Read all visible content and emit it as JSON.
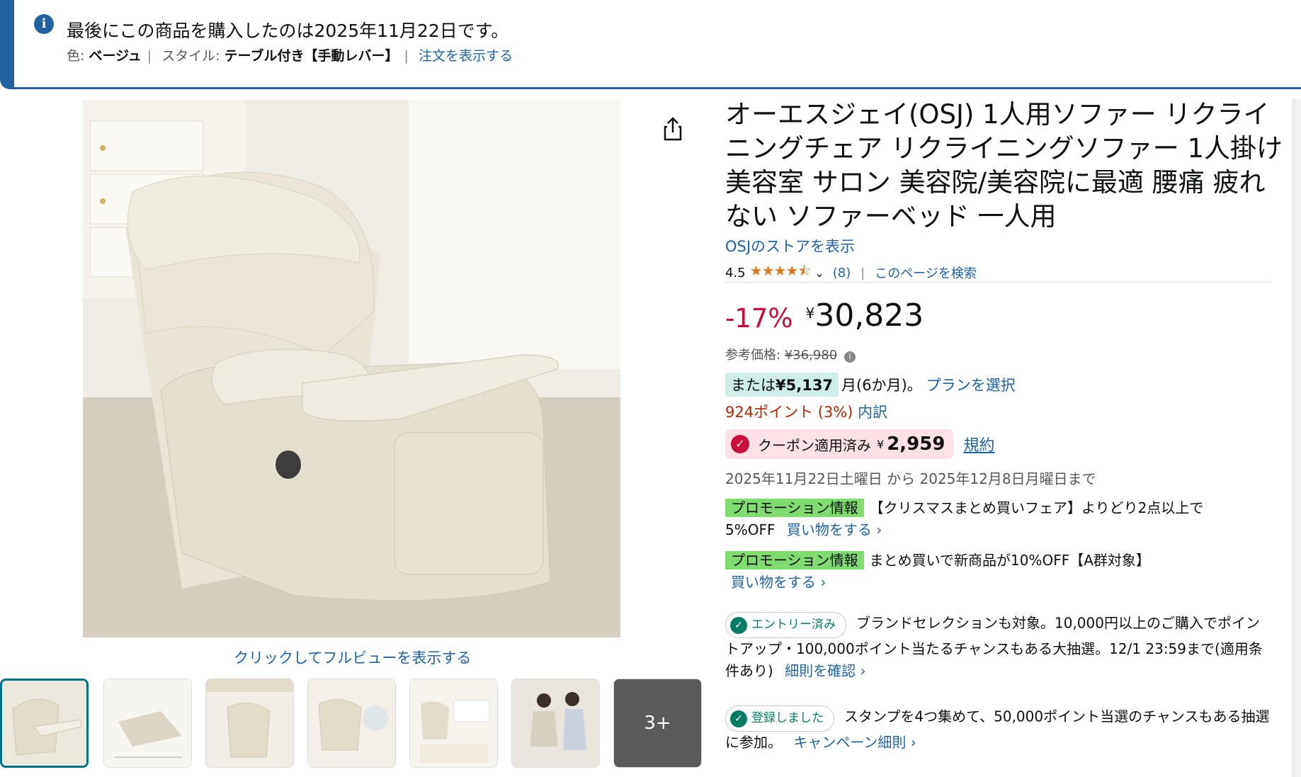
{
  "banner": {
    "title": "最後にこの商品を購入したのは2025年11月22日です。",
    "color_label": "色:",
    "color_value": "ベージュ",
    "style_label": "スタイル:",
    "style_value": "テーブル付き【手動レバー】",
    "view_order": "注文を表示する"
  },
  "gallery": {
    "fullview": "クリックしてフルビューを表示する",
    "thumbnails": [
      {
        "name": "thumb-1",
        "active": true
      },
      {
        "name": "thumb-2"
      },
      {
        "name": "thumb-3"
      },
      {
        "name": "thumb-4"
      },
      {
        "name": "thumb-5"
      },
      {
        "name": "thumb-6"
      }
    ],
    "more": "3+"
  },
  "product": {
    "title": "オーエスジェイ(OSJ) 1人用ソファー リクライニングチェア リクライニングソファー 1人掛け 美容室 サロン 美容院/美容院に最適 腰痛 疲れない ソファーベッド 一人用",
    "store_link": "OSJのストアを表示",
    "rating": "4.5",
    "stars": "★★★★⯪",
    "review_count": "(8)",
    "search_page": "このページを検索"
  },
  "price": {
    "discount": "-17%",
    "currency": "¥",
    "value": "30,823",
    "ref_label": "参考価格:",
    "ref_value": "¥36,980",
    "plan_prefix": "または",
    "plan_amount": "¥5,137",
    "plan_suffix": "月(6か月)。",
    "plan_link": "プランを選択",
    "points": "924ポイント (3%)",
    "points_link": "内訳"
  },
  "coupon": {
    "label": "クーポン適用済み",
    "currency": "¥",
    "value": "2,959",
    "rule": "規約",
    "dates": "2025年11月22日土曜日 から 2025年12月8日月曜日まで"
  },
  "promos": [
    {
      "tag": "プロモーション情報",
      "text": "【クリスマスまとめ買いフェア】よりどり2点以上で5%OFF",
      "link": "買い物をする ›"
    },
    {
      "tag": "プロモーション情報",
      "text": "まとめ買いで新商品が10%OFF【A群対象】",
      "link": "買い物をする ›"
    }
  ],
  "entries": [
    {
      "pill": "エントリー済み",
      "text": "ブランドセレクションも対象。10,000円以上のご購入でポイントアップ・100,000ポイント当たるチャンスもある大抽選。12/1 23:59まで(適用条件あり)",
      "link": "細則を確認 ›"
    },
    {
      "pill": "登録しました",
      "text": "スタンプを4つ集めて、50,000ポイント当選のチャンスもある抽選に参加。",
      "link": "キャンペーン細則 ›"
    }
  ],
  "colors": {
    "link": "#2162a1",
    "discount": "#cc0c39",
    "promo": "#7fdc6e",
    "banner": "#2162a1"
  }
}
